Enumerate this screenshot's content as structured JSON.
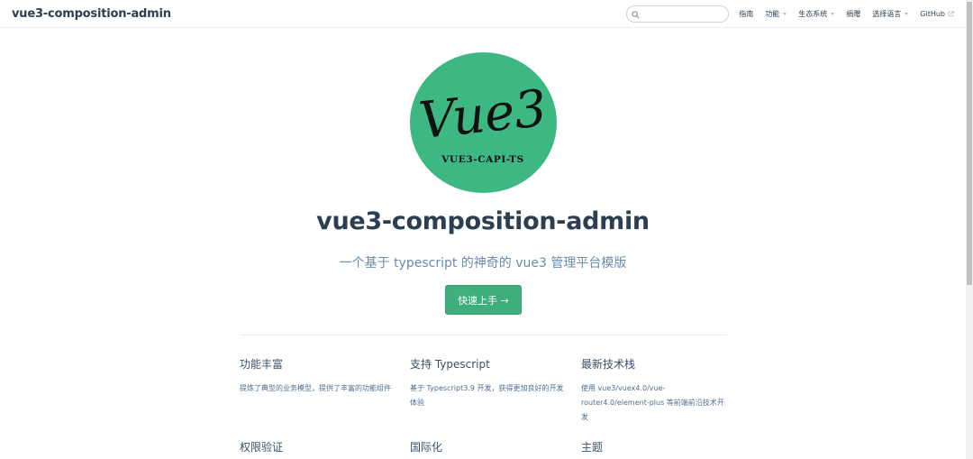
{
  "navbar": {
    "site_name": "vue3-composition-admin",
    "search": {
      "placeholder": "",
      "value": ""
    },
    "items": [
      {
        "label": "指南",
        "dropdown": false
      },
      {
        "label": "功能",
        "dropdown": true
      },
      {
        "label": "生态系统",
        "dropdown": true
      },
      {
        "label": "捐赠",
        "dropdown": false
      },
      {
        "label": "选择语言",
        "dropdown": true
      },
      {
        "label": "GitHub",
        "external": true
      }
    ]
  },
  "hero": {
    "logo_text": "Vue3",
    "logo_subtext": "VUE3-CAPI-TS",
    "logo_color": "#3eb883",
    "title": "vue3-composition-admin",
    "description": "一个基于 typescript 的神奇的 vue3 管理平台模版",
    "action_label": "快速上手 →"
  },
  "features": [
    {
      "title": "功能丰富",
      "details": "提炼了典型的业务模型，提供了丰富的功能组件"
    },
    {
      "title": "支持 Typescript",
      "details": "基于 Typescript3.9 开发，获得更加良好的开发体验"
    },
    {
      "title": "最新技术栈",
      "details": "使用 vue3/vuex4.0/vue-router4.0/element-plus 等前端前沿技术开发"
    },
    {
      "title": "权限验证",
      "details": ""
    },
    {
      "title": "国际化",
      "details": ""
    },
    {
      "title": "主题",
      "details": ""
    }
  ],
  "colors": {
    "accent": "#3eaf7c",
    "text": "#2c3e50",
    "description": "#6a8bad"
  }
}
